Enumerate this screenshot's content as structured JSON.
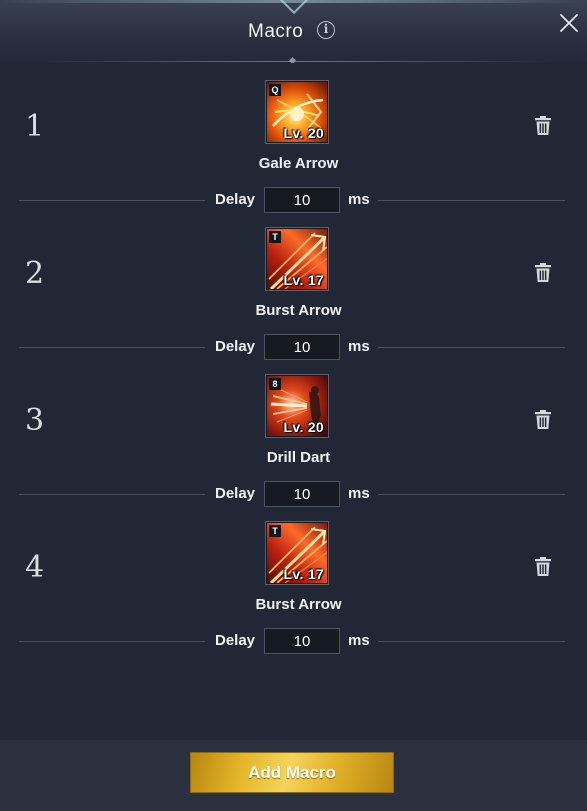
{
  "window": {
    "title": "Macro",
    "close_icon": "close-icon",
    "info_icon": "info-icon",
    "info_glyph": "i"
  },
  "macros": [
    {
      "number": "1",
      "skill_name": "Gale Arrow",
      "level": "Lv. 20",
      "key": "Q",
      "delay_label": "Delay",
      "delay_value": "10",
      "delay_unit": "ms",
      "icon": "gale-arrow-skill-icon"
    },
    {
      "number": "2",
      "skill_name": "Burst Arrow",
      "level": "Lv. 17",
      "key": "T",
      "delay_label": "Delay",
      "delay_value": "10",
      "delay_unit": "ms",
      "icon": "burst-arrow-skill-icon"
    },
    {
      "number": "3",
      "skill_name": "Drill Dart",
      "level": "Lv. 20",
      "key": "8",
      "delay_label": "Delay",
      "delay_value": "10",
      "delay_unit": "ms",
      "icon": "drill-dart-skill-icon"
    },
    {
      "number": "4",
      "skill_name": "Burst Arrow",
      "level": "Lv. 17",
      "key": "T",
      "delay_label": "Delay",
      "delay_value": "10",
      "delay_unit": "ms",
      "icon": "burst-arrow-skill-icon"
    }
  ],
  "footer": {
    "add_button_label": "Add Macro"
  },
  "colors": {
    "background": "#212734",
    "header": "#2a3040",
    "footer": "#2a303d",
    "accent_gold": "#e3b52a",
    "text": "#eef0f3"
  }
}
